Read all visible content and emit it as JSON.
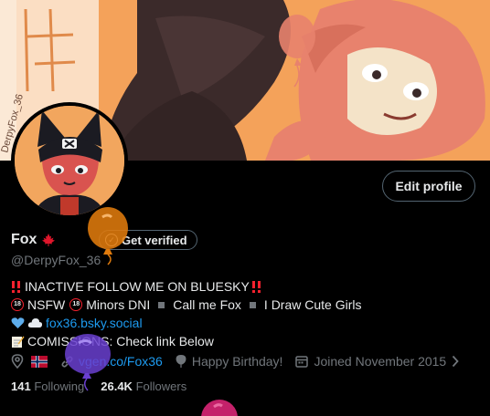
{
  "banner": {
    "signature": "DerpyFox_36",
    "alt": "banner artwork"
  },
  "profile": {
    "display_name": "Fox",
    "handle": "@DerpyFox_36",
    "edit_profile_label": "Edit profile",
    "get_verified_label": "Get verified",
    "check_glyph": "✓"
  },
  "bio": {
    "line1": "‼️INACTIVE FOLLOW ME ON BLUESKY‼️",
    "line1_text": "INACTIVE FOLLOW ME ON BLUESKY",
    "nsfw": "NSFW",
    "minors": "Minors DNI",
    "call_me": "Call me Fox",
    "draw": "I Draw Cute Girls",
    "badge_18": "18",
    "bsky_link": "fox36.bsky.social",
    "commissions": "COMISSIONS: Check link Below"
  },
  "meta": {
    "website": "vgen.co/Fox36",
    "birthday": "Happy Birthday!",
    "joined": "Joined November 2015",
    "chevron": "›"
  },
  "stats": {
    "following_count": "141",
    "following_label": "Following",
    "followers_count": "26.4K",
    "followers_label": "Followers"
  },
  "colors": {
    "background": "#000000",
    "text": "#e7e9ea",
    "muted": "#71767b",
    "link": "#1d9bf0",
    "border": "#536471",
    "banner_orange": "#f4a25a",
    "balloon_orange": "#e07b0d",
    "balloon_purple": "#6a3fd0",
    "balloon_magenta": "#c4216a"
  },
  "icons": [
    "maple-leaf-icon",
    "check-icon",
    "location-icon",
    "norway-flag-icon",
    "link-icon",
    "balloon-icon",
    "calendar-icon",
    "chevron-right-icon",
    "blue-heart-icon",
    "cloud-icon",
    "memo-icon",
    "double-exclamation-icon"
  ]
}
